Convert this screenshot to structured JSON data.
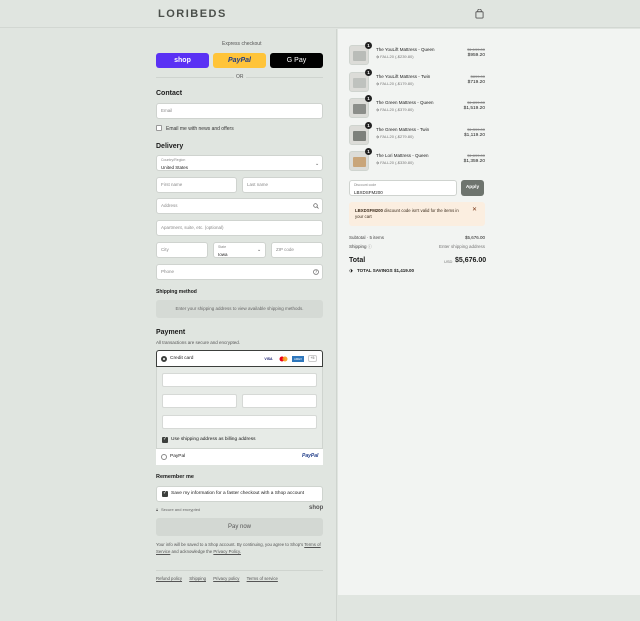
{
  "brand": {
    "name": "LORIBEDS"
  },
  "express": {
    "title": "Express checkout",
    "shop": "shop",
    "paypal": "PayPal",
    "gpay": "G Pay",
    "or": "OR"
  },
  "contact": {
    "heading": "Contact",
    "email_placeholder": "Email",
    "newsletter_label": "Email me with news and offers"
  },
  "delivery": {
    "heading": "Delivery",
    "country_label": "Country/Region",
    "country_value": "United States",
    "first_name": "First name",
    "last_name": "Last name",
    "address": "Address",
    "apartment": "Apartment, suite, etc. (optional)",
    "city": "City",
    "state_label": "State",
    "state_value": "Iowa",
    "zip": "ZIP code",
    "phone": "Phone"
  },
  "shipping_method": {
    "heading": "Shipping method",
    "message": "Enter your shipping address to view available shipping methods."
  },
  "payment": {
    "heading": "Payment",
    "subtext": "All transactions are secure and encrypted.",
    "credit_card": "Credit card",
    "cards": [
      "VISA",
      "MC",
      "AMEX",
      "+5"
    ],
    "billing_label": "Use shipping address as billing address",
    "paypal": "PayPal",
    "paypal_logo": "PayPal"
  },
  "remember": {
    "heading": "Remember me",
    "label": "Save my information for a faster checkout with a Shop account",
    "secure": "Secure and encrypted",
    "shop": "shop"
  },
  "pay_button": "Pay now",
  "legal": {
    "text": "Your info will be saved to a Shop account. By continuing, you agree to Shop's",
    "terms": "Terms of Service",
    "and": "and acknowledge the",
    "privacy": "Privacy Policy."
  },
  "footer_links": [
    "Refund policy",
    "Shipping",
    "Privacy policy",
    "Terms of service"
  ],
  "cart": {
    "items": [
      {
        "qty": "1",
        "name": "The YouLift Mattress - Queen",
        "variant": "FALL20 (-$239.80)",
        "old": "$1,199.00",
        "new": "$959.20",
        "color": "#b9bcb8"
      },
      {
        "qty": "1",
        "name": "The YouLift Mattress - Twin",
        "variant": "FALL20 (-$179.80)",
        "old": "$899.00",
        "new": "$719.20",
        "color": "#bfc2be"
      },
      {
        "qty": "1",
        "name": "The Green Mattress - Queen",
        "variant": "FALL20 (-$379.80)",
        "old": "$1,899.00",
        "new": "$1,519.20",
        "color": "#8c8e8a"
      },
      {
        "qty": "1",
        "name": "The Green Mattress - Twin",
        "variant": "FALL20 (-$279.80)",
        "old": "$1,399.00",
        "new": "$1,119.20",
        "color": "#7d807b"
      },
      {
        "qty": "1",
        "name": "The Lori Mattress - Queen",
        "variant": "FALL20 (-$339.80)",
        "old": "$1,699.00",
        "new": "$1,359.20",
        "color": "#c9a57a"
      }
    ],
    "discount_label": "Discount code",
    "discount_value": "LBXDSFM200",
    "apply": "Apply",
    "error_code": "LBXDSFM200",
    "error_text": "discount code isn't valid for the items in your cart",
    "subtotal_label": "Subtotal · 5 items",
    "subtotal_value": "$5,676.00",
    "shipping_label": "Shipping",
    "shipping_value": "Enter shipping address",
    "total_label": "Total",
    "currency": "USD",
    "total_value": "$5,676.00",
    "savings_label": "TOTAL SAVINGS",
    "savings_value": "$1,419.00"
  },
  "colors": {
    "shop": "#5a31f4",
    "paypal": "#ffc439",
    "gpay": "#000000",
    "apply": "#6e746e",
    "error_bg": "#fbeee0"
  }
}
